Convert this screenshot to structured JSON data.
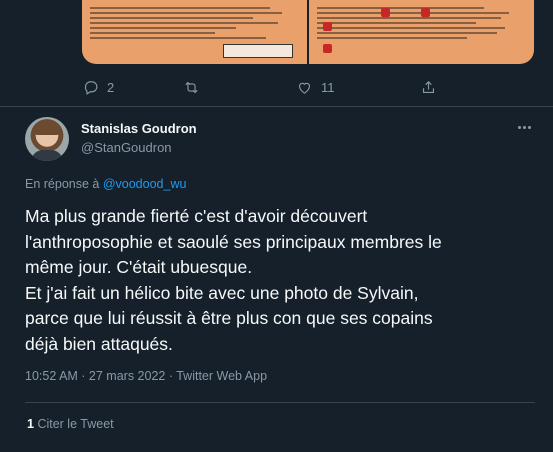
{
  "previous_tweet": {
    "actions": {
      "reply_count": "2",
      "retweet_count": "",
      "like_count": "11"
    }
  },
  "tweet": {
    "author_name": "Stanislas Goudron",
    "author_handle": "@StanGoudron",
    "reply_prefix": "En réponse à ",
    "reply_to": "@voodood_wu",
    "text": "Ma plus grande fierté c'est d'avoir découvert\nl'anthroposophie et saoulé ses principaux membres le\nmême jour. C'était ubuesque.\nEt j'ai fait un hélico bite avec une photo de Sylvain,\nparce que lui réussit à être plus con que ses copains\ndéjà bien attaqués.",
    "timestamp": "10:52 AM · 27 mars 2022 · Twitter Web App",
    "quote_count": "1",
    "quote_label": "Citer le Tweet"
  },
  "colors": {
    "background": "#15202b",
    "accent": "#1d9bf0",
    "muted": "#8b98a5",
    "divider": "#38444d"
  }
}
